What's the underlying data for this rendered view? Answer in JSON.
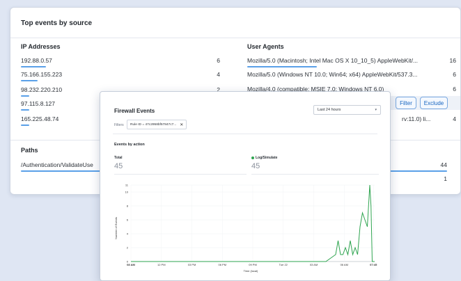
{
  "back_panel": {
    "title": "Top events by source",
    "ip_header": "IP Addresses",
    "ip_rows": [
      {
        "label": "192.88.0.57",
        "count": "6"
      },
      {
        "label": "75.166.155.223",
        "count": "4"
      },
      {
        "label": "98.232.220.210",
        "count": "2"
      },
      {
        "label": "97.115.8.127",
        "count": ""
      },
      {
        "label": "165.225.48.74",
        "count": ""
      }
    ],
    "ua_header": "User Agents",
    "ua_rows": [
      {
        "label": "Mozilla/5.0 (Macintosh; Intel Mac OS X 10_10_5) AppleWebKit/...",
        "count": "16"
      },
      {
        "label": "Mozilla/5.0 (Windows NT 10.0; Win64; x64) AppleWebKit/537.3...",
        "count": "6"
      },
      {
        "label": "Mozilla/4.0 (compatible; MSIE 7.0; Windows NT 6.0)",
        "count": "6"
      },
      {
        "label": "",
        "count": ""
      },
      {
        "label": "rv:11.0) li...",
        "count": "4"
      }
    ],
    "filter_label": "Filter",
    "exclude_label": "Exclude",
    "paths_header": "Paths",
    "path_rows": [
      {
        "label": "/Authentication/ValidateUse",
        "count": "44"
      },
      {
        "label": "",
        "count": "1"
      }
    ]
  },
  "front_panel": {
    "title": "Firewall Events",
    "time_range": "Last 24 hours",
    "filters_label": "Filters",
    "filter_chip": "Rule ID = 47c2958bf57847c7...",
    "section_title": "Events by action",
    "total_label": "Total",
    "total_value": "45",
    "log_label": "Log/Simulate",
    "log_value": "45"
  },
  "chart_data": {
    "type": "line",
    "ylabel": "Number of Events",
    "xlabel": "Time (local)",
    "ylim": [
      0,
      11
    ],
    "y_ticks": [
      "0",
      "2",
      "4",
      "6",
      "8",
      "10",
      "11"
    ],
    "x_tick_labels": [
      "08 AM",
      "12 PM",
      "03 PM",
      "06 PM",
      "09 PM",
      "Tue 22",
      "03 AM",
      "06 AM",
      "07:45"
    ],
    "series": [
      {
        "color": "#2ea44f",
        "x": [
          0,
          0.7,
          0.75,
          0.78,
          0.8,
          0.82,
          0.84,
          0.85,
          0.86,
          0.87,
          0.88,
          0.89,
          0.9,
          0.91,
          0.92,
          0.93,
          0.94,
          0.95,
          0.96,
          0.97,
          0.98,
          0.985,
          0.99,
          1.0
        ],
        "y": [
          0,
          0,
          0,
          0,
          0,
          0.5,
          1,
          3,
          1,
          1,
          2,
          1,
          3,
          1,
          2,
          1,
          5,
          7,
          6,
          5,
          11,
          8,
          0,
          0
        ]
      }
    ]
  },
  "colors": {
    "accent": "#1665c0",
    "underline": "#5aa0e8",
    "series": "#2ea44f"
  }
}
